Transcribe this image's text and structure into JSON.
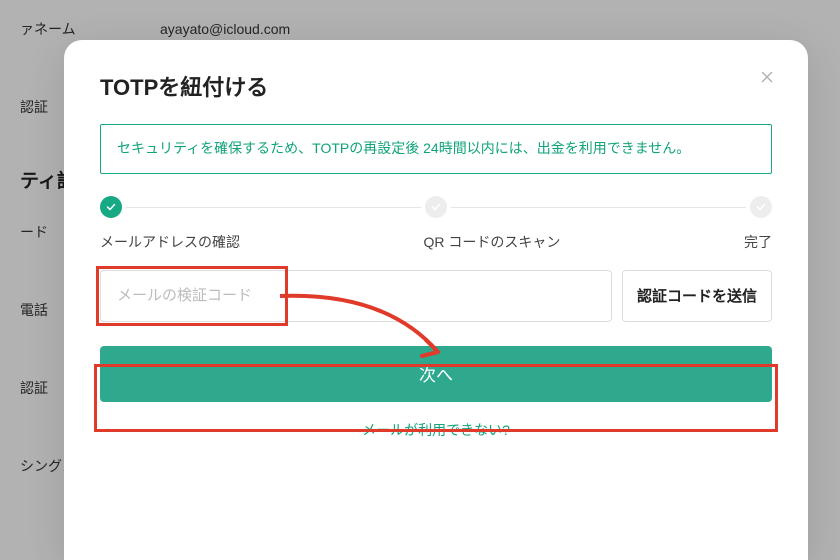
{
  "background": {
    "username_label": "ァネーム",
    "username_value": "ayayato@icloud.com",
    "row2_label": "認証",
    "section_header": "ティ設定",
    "row3_label": "ード",
    "row4_label": "電話",
    "row5_label": "認証",
    "row6_label": "シングメ"
  },
  "modal": {
    "title": "TOTPを紐付ける",
    "notice": "セキュリティを確保するため、TOTPの再設定後 24時間以内には、出金を利用できません。",
    "steps": {
      "step1_label": "メールアドレスの確認",
      "step2_label": "QR コードのスキャン",
      "step3_label": "完了"
    },
    "input_placeholder": "メールの検証コード",
    "send_button": "認証コードを送信",
    "next_button": "次へ",
    "cant_email": "メールが利用できない?"
  }
}
